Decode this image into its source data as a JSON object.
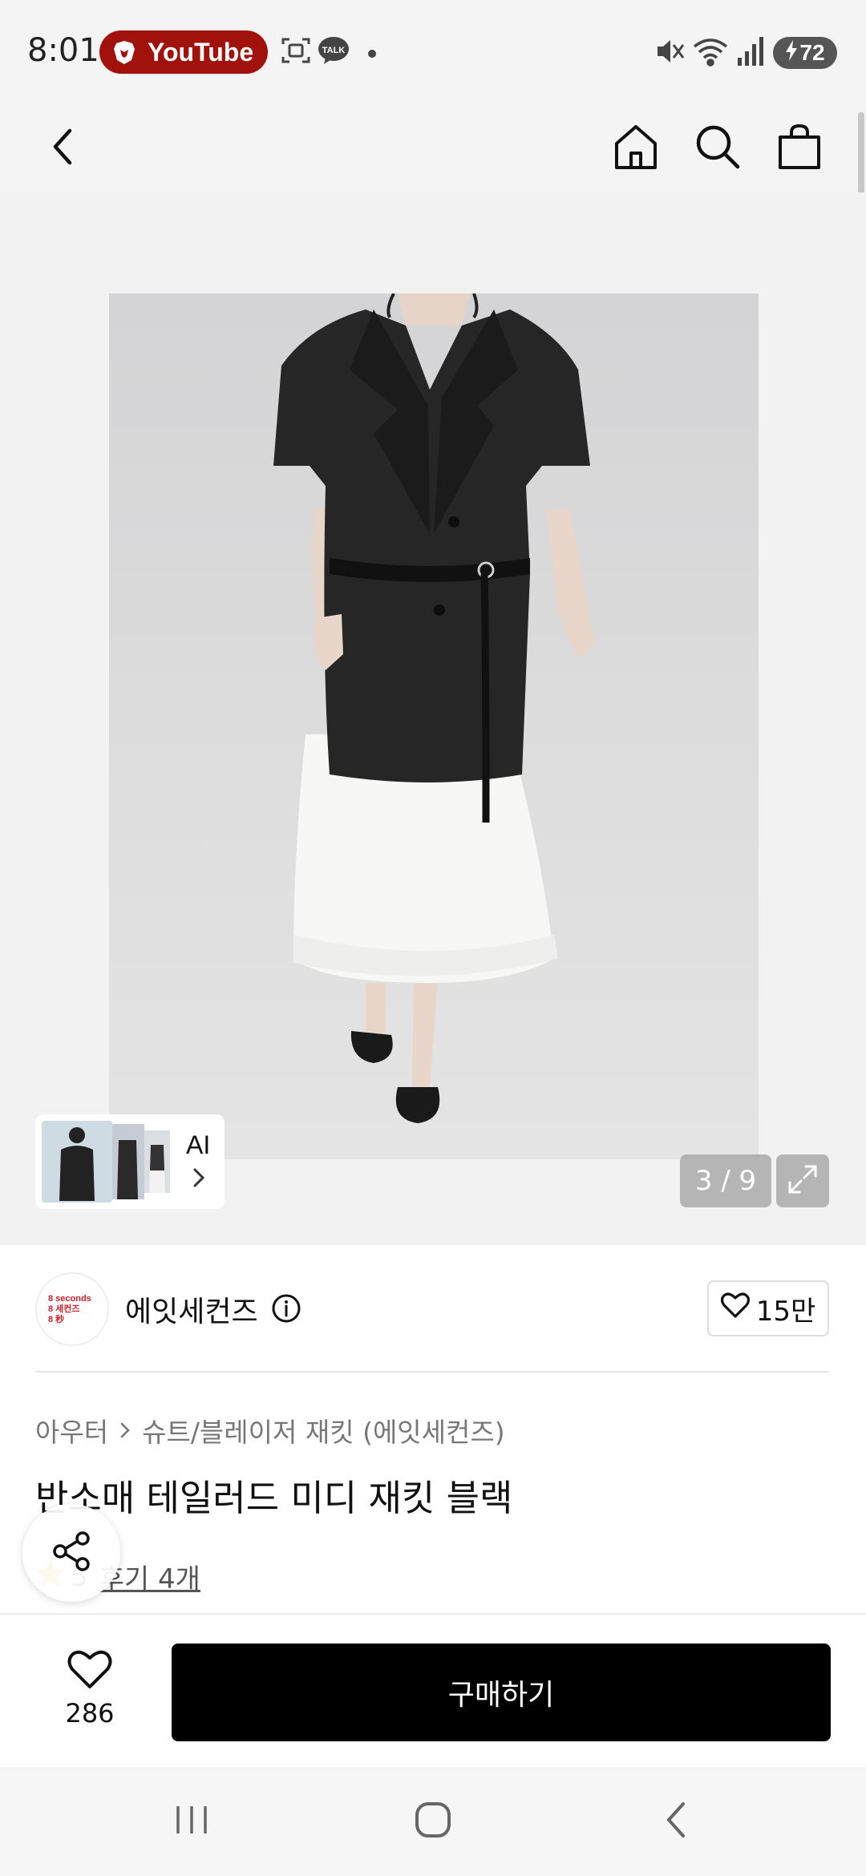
{
  "status_bar": {
    "time": "8:01",
    "app_pill": "YouTube",
    "battery": "72"
  },
  "gallery": {
    "ai_label": "AI",
    "counter": "3 / 9"
  },
  "brand": {
    "logo_lines": [
      "8 seconds",
      "8 세컨즈",
      "8 秒"
    ],
    "name": "에잇세컨즈",
    "likes": "15만"
  },
  "product": {
    "breadcrumb": [
      "아우터",
      "슈트/블레이저 재킷 (에잇세컨즈)"
    ],
    "title": "반소매 테일러드 미디 재킷 블랙",
    "rating": "5",
    "reviews": "후기 4개"
  },
  "bottom_bar": {
    "wish_count": "286",
    "buy_label": "구매하기"
  },
  "colors": {
    "youtube_pill": "#a2120d",
    "buy_button": "#000000",
    "star": "#f5a623"
  }
}
